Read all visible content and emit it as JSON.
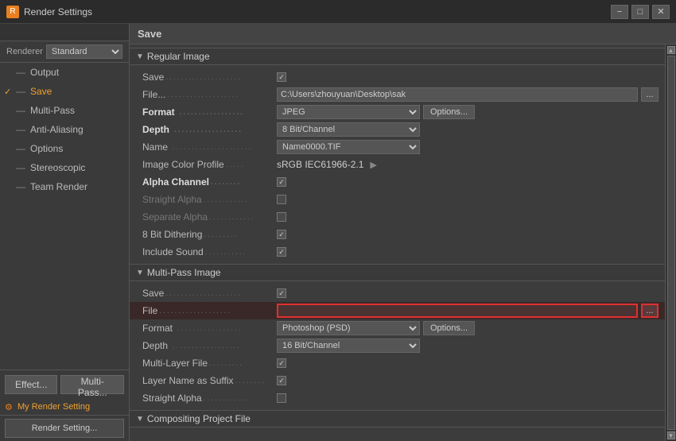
{
  "window": {
    "title": "Render Settings",
    "icon": "R"
  },
  "titlebar": {
    "minimize": "−",
    "maximize": "□",
    "close": "✕"
  },
  "sidebar": {
    "renderer_label": "Renderer",
    "renderer_value": "Standard",
    "items": [
      {
        "label": "Output",
        "prefix": "—",
        "active": false,
        "checked": false
      },
      {
        "label": "Save",
        "prefix": "—",
        "active": true,
        "checked": true
      },
      {
        "label": "Multi-Pass",
        "prefix": "—",
        "active": false,
        "checked": false
      },
      {
        "label": "Anti-Aliasing",
        "prefix": "—",
        "active": false,
        "checked": false
      },
      {
        "label": "Options",
        "prefix": "—",
        "active": false,
        "checked": false
      },
      {
        "label": "Stereoscopic",
        "prefix": "—",
        "active": false,
        "checked": false
      },
      {
        "label": "Team Render",
        "prefix": "—",
        "active": false,
        "checked": false
      }
    ],
    "footer_label": "My Render Setting",
    "render_btn": "Render Setting..."
  },
  "content": {
    "header": "Save",
    "sections": {
      "regular_image": {
        "title": "Regular Image",
        "save_label": "Save",
        "save_checked": true,
        "file_label": "File...",
        "file_value": "C:\\Users\\zhouyuan\\Desktop\\sak",
        "format_label": "Format",
        "format_value": "JPEG",
        "options_btn": "Options...",
        "depth_label": "Depth",
        "depth_value": "8 Bit/Channel",
        "name_label": "Name",
        "name_value": "Name0000.TIF",
        "image_color_profile_label": "Image Color Profile",
        "image_color_profile_value": "sRGB IEC61966-2.1",
        "alpha_channel_label": "Alpha Channel",
        "alpha_channel_checked": true,
        "straight_alpha_label": "Straight Alpha",
        "straight_alpha_checked": false,
        "separate_alpha_label": "Separate Alpha",
        "separate_alpha_checked": false,
        "dithering_label": "8 Bit Dithering",
        "dithering_checked": true,
        "include_sound_label": "Include Sound",
        "include_sound_checked": true
      },
      "multipass_image": {
        "title": "Multi-Pass Image",
        "save_label": "Save",
        "save_checked": true,
        "file_label": "File",
        "file_value": "",
        "format_label": "Format",
        "format_value": "Photoshop (PSD)",
        "options_btn": "Options...",
        "depth_label": "Depth",
        "depth_value": "16 Bit/Channel",
        "multilayer_label": "Multi-Layer File",
        "multilayer_checked": true,
        "layer_name_suffix_label": "Layer Name as Suffix",
        "layer_name_suffix_checked": true,
        "straight_alpha_label": "Straight Alpha",
        "straight_alpha_checked": false
      },
      "compositing": {
        "title": "Compositing Project File"
      }
    }
  }
}
